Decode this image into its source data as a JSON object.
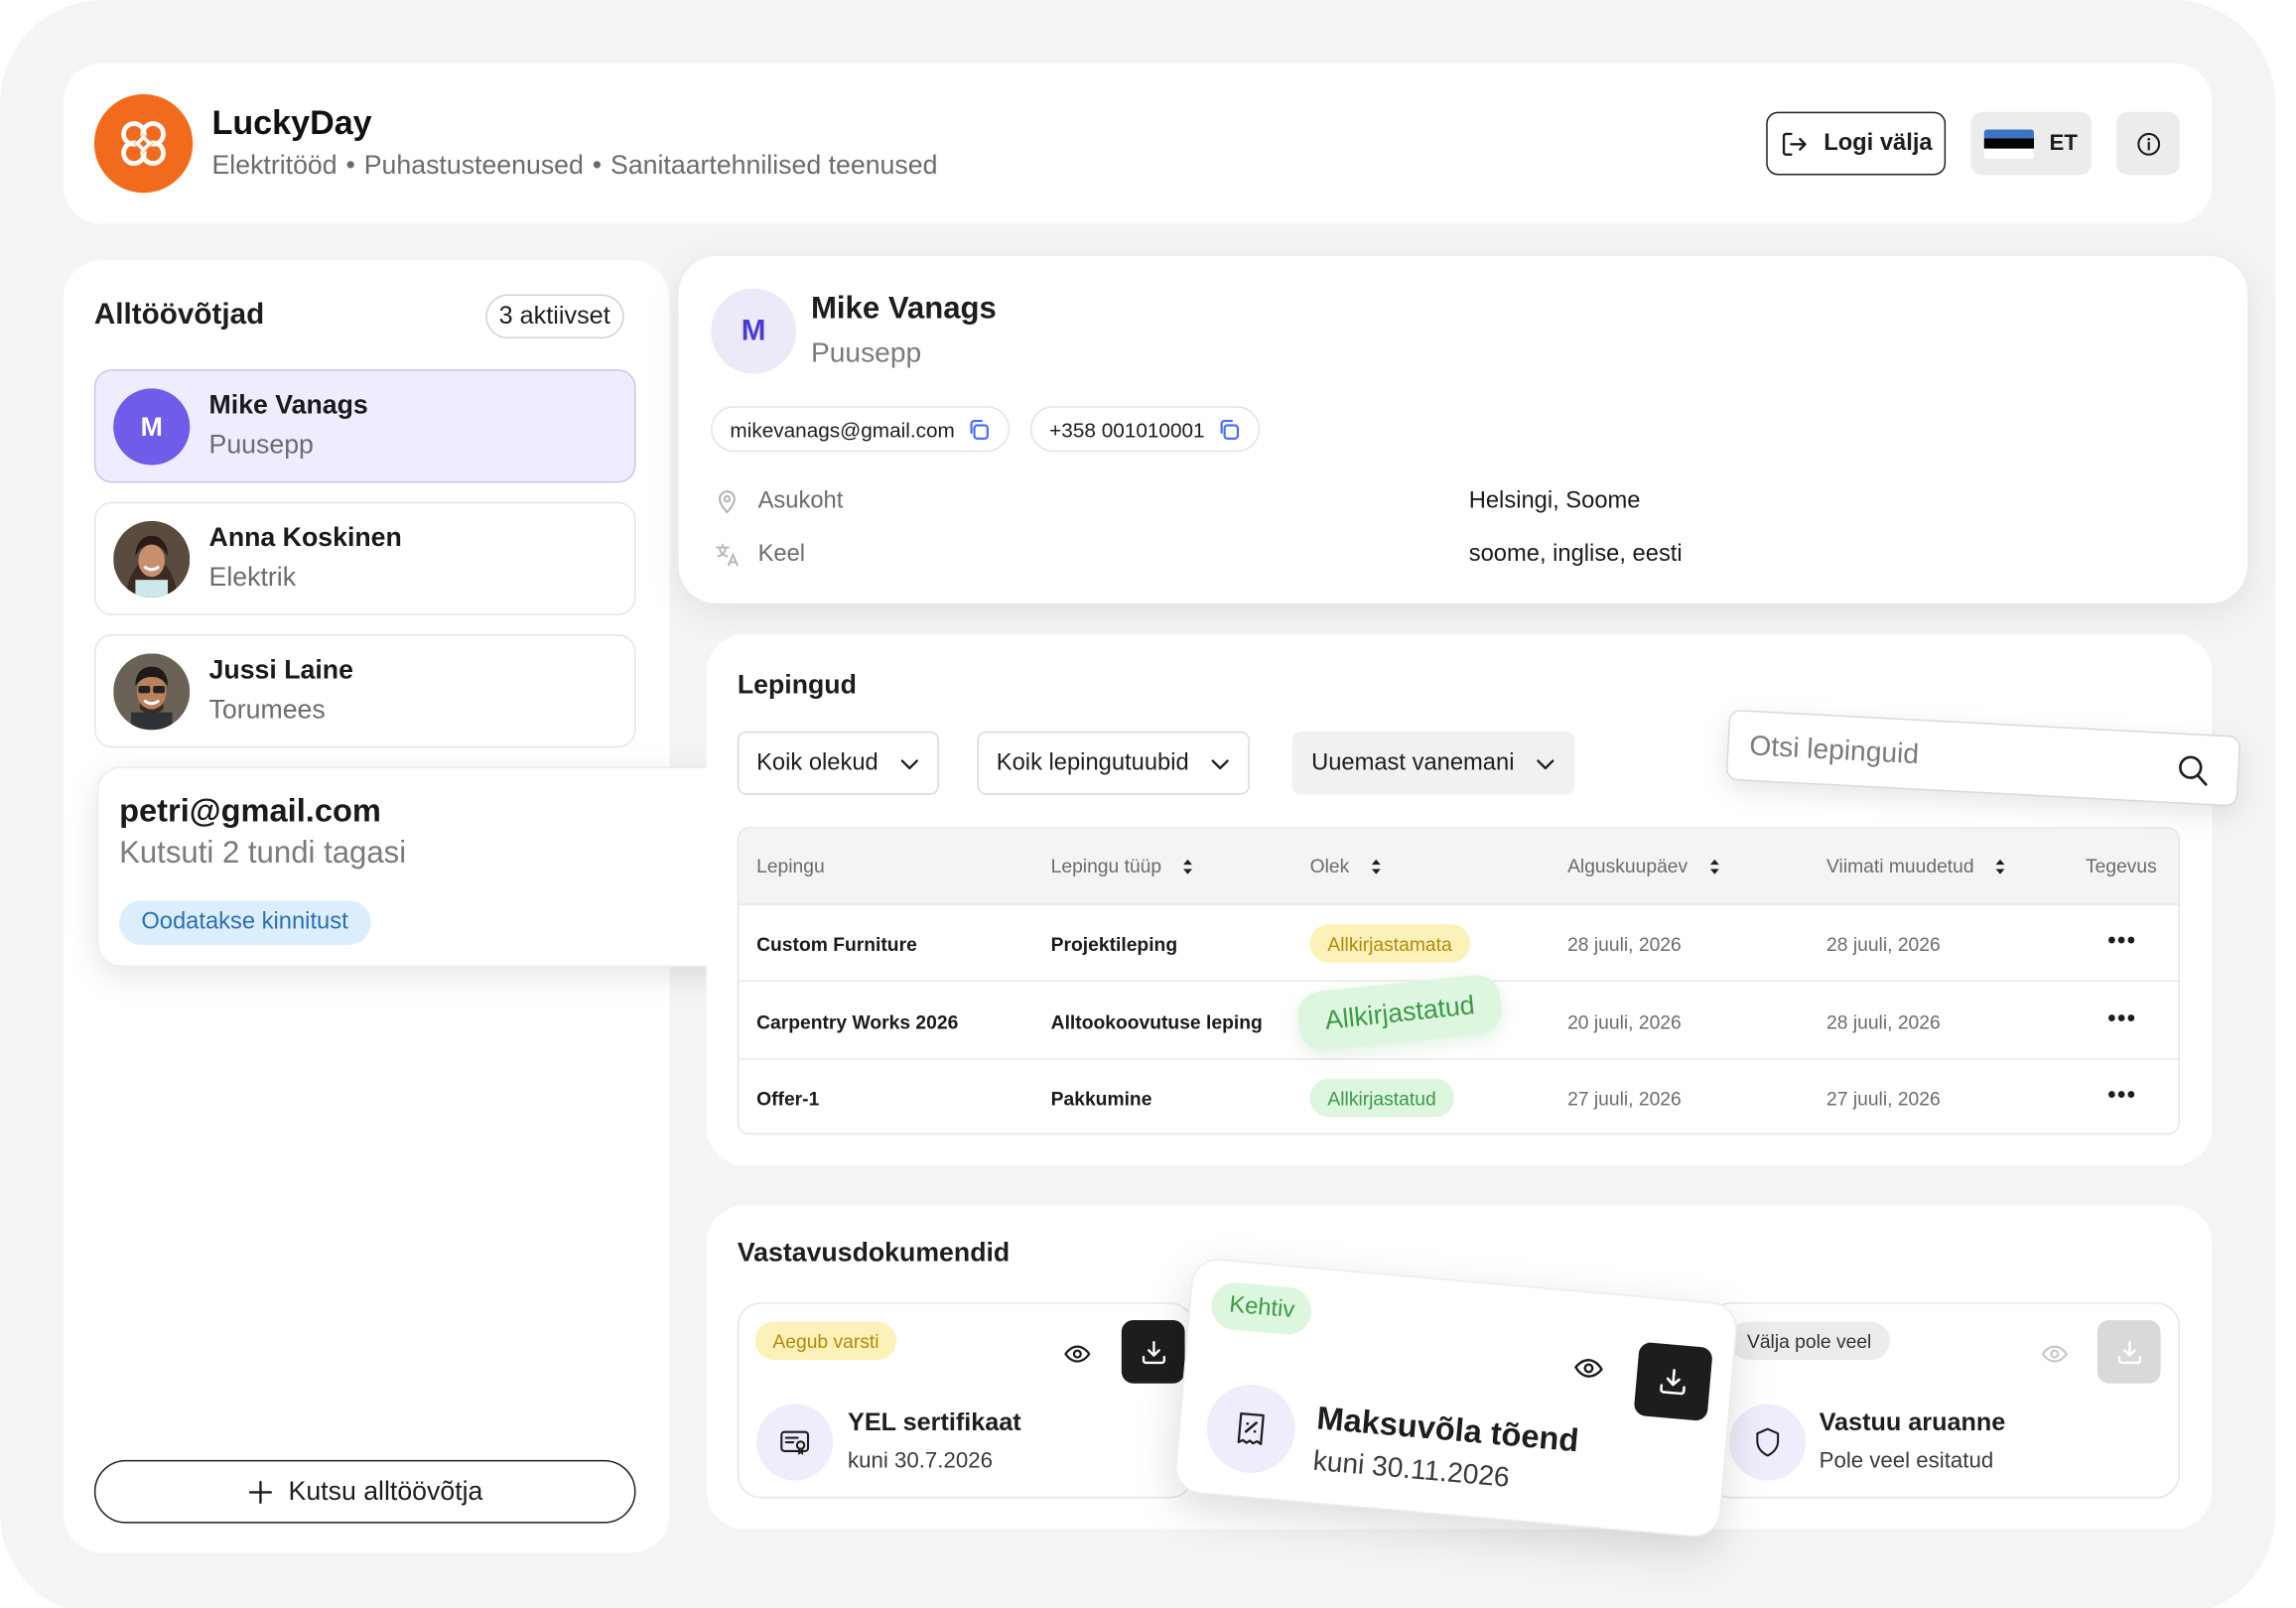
{
  "header": {
    "brand": "LuckyDay",
    "services": [
      "Elektritööd",
      "Puhastusteenused",
      "Sanitaartehnilised teenused"
    ],
    "separator": "•",
    "logout_label": "Logi välja",
    "lang_label": "ET",
    "flag_colors": [
      "#3a75c4",
      "#000000",
      "#ffffff"
    ]
  },
  "sidebar": {
    "title": "Alltöövõtjad",
    "badge": "3 aktiivset",
    "people": [
      {
        "name": "Mike Vanags",
        "role": "Puusepp",
        "initial": "M"
      },
      {
        "name": "Anna Koskinen",
        "role": "Elektrik"
      },
      {
        "name": "Jussi Laine",
        "role": "Torumees"
      }
    ],
    "invite_label": "Kutsu alltöövõtja",
    "pending_invite": {
      "email": "petri@gmail.com",
      "sent": "Kutsuti 2 tundi tagasi",
      "status": "Oodatakse kinnitust"
    }
  },
  "profile": {
    "initial": "M",
    "name": "Mike Vanags",
    "role": "Puusepp",
    "email": "mikevanags@gmail.com",
    "phone": "+358 001010001",
    "location_label": "Asukoht",
    "location_value": "Helsingi, Soome",
    "language_label": "Keel",
    "language_value": "soome, inglise, eesti"
  },
  "contracts": {
    "title": "Lepingud",
    "filters": [
      "Koik olekud",
      "Koik lepingutuubid",
      "Uuemast vanemani"
    ],
    "search_placeholder": "Otsi lepinguid",
    "columns": [
      "Lepingu",
      "Lepingu tüüp",
      "Olek",
      "Alguskuupäev",
      "Viimati muudetud",
      "Tegevus"
    ],
    "rows": [
      {
        "name": "Custom Furniture",
        "type": "Projektileping",
        "status": "Allkirjastamata",
        "start": "28 juuli, 2026",
        "modified": "28 juuli, 2026",
        "action": "•••"
      },
      {
        "name": "Carpentry Works 2026",
        "type": "Alltookoovutuse leping",
        "status": "Allkirjastatud",
        "start": "20 juuli, 2026",
        "modified": "28 juuli, 2026",
        "action": "•••"
      },
      {
        "name": "Offer-1",
        "type": "Pakkumine",
        "status": "Allkirjastatud",
        "start": "27 juuli, 2026",
        "modified": "27 juuli, 2026",
        "action": "•••"
      }
    ]
  },
  "documents": {
    "title": "Vastavusdokumendid",
    "items": [
      {
        "status": "Aegub varsti",
        "name": "YEL sertifikaat",
        "sub": "kuni 30.7.2026"
      },
      {
        "status": "Kehtiv",
        "name": "Maksuvõla tõend",
        "sub": "kuni 30.11.2026"
      },
      {
        "status": "Välja pole veel",
        "name": "Vastuu aruanne",
        "sub": "Pole veel esitatud"
      }
    ]
  },
  "colors": {
    "brand_orange": "#f26b1d",
    "accent_purple": "#6f5ce8",
    "status_yellow": "#fcf1b8",
    "status_green": "#ddf6df",
    "status_blue": "#dceefc"
  }
}
